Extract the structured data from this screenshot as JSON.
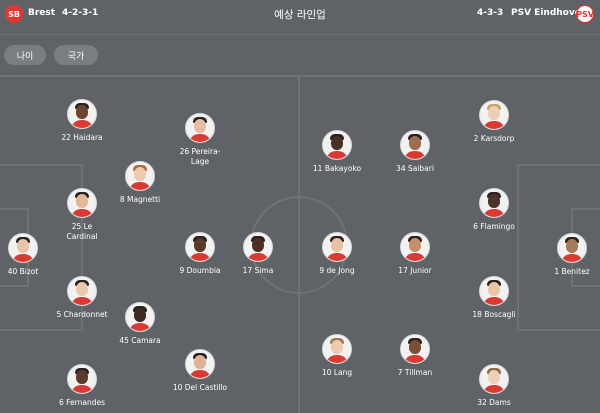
{
  "header": {
    "title": "예상 라인업",
    "home": {
      "name": "Brest",
      "formation": "4-2-3-1",
      "logo_text": "SB"
    },
    "away": {
      "name": "PSV Eindhoven",
      "formation": "4-3-3",
      "logo_text": "PSV"
    }
  },
  "filters": [
    {
      "label": "나이"
    },
    {
      "label": "국가"
    }
  ],
  "colors": {
    "background": "#5f6368",
    "pitch_lines": "#6f7378",
    "button": "#7a7e83",
    "brest_red": "#e2362f"
  },
  "home_players": [
    {
      "label": "40 Bizot"
    },
    {
      "label": "22 Haidara"
    },
    {
      "label": "25 Le Cardinal"
    },
    {
      "label": "5 Chardonnet"
    },
    {
      "label": "6 Fernandes"
    },
    {
      "label": "8 Magnetti"
    },
    {
      "label": "45 Camara"
    },
    {
      "label": "26 Pereira-Lage"
    },
    {
      "label": "9 Doumbia"
    },
    {
      "label": "10 Del Castillo"
    },
    {
      "label": "17 Sima"
    }
  ],
  "away_players": [
    {
      "label": "1 Benitez"
    },
    {
      "label": "2 Karsdorp"
    },
    {
      "label": "6 Flamingo"
    },
    {
      "label": "18 Boscagli"
    },
    {
      "label": "32 Dams"
    },
    {
      "label": "34 Saibari"
    },
    {
      "label": "17 Junior"
    },
    {
      "label": "7 Tillman"
    },
    {
      "label": "11 Bakayoko"
    },
    {
      "label": "9 de Jong"
    },
    {
      "label": "10 Lang"
    }
  ]
}
